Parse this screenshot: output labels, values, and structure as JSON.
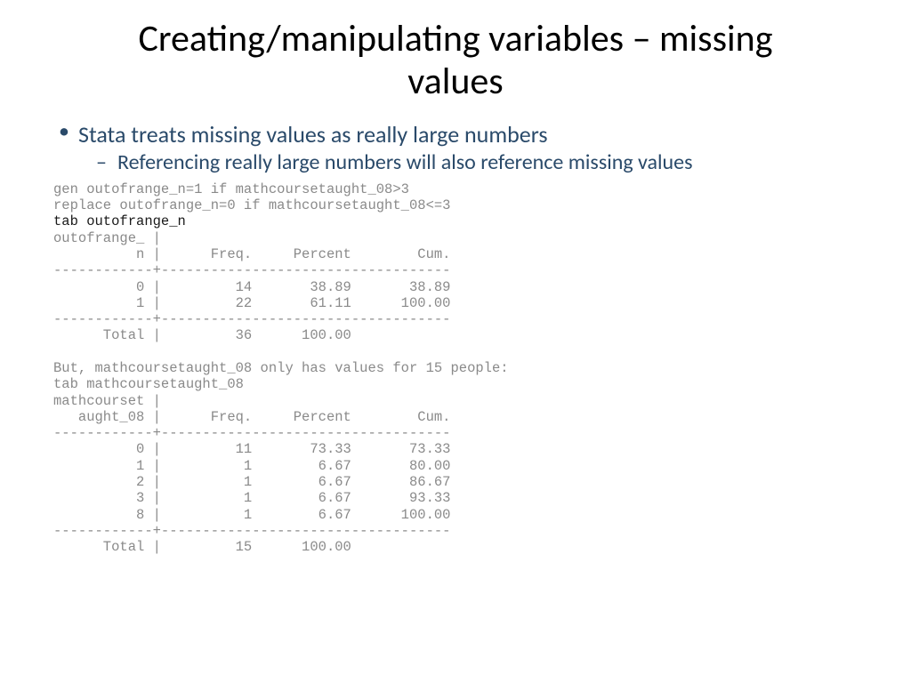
{
  "title": "Creating/manipulating variables – missing values",
  "bullets": {
    "outer": "Stata treats missing values as really large numbers",
    "inner": "Referencing really large numbers will also reference missing values"
  },
  "code": {
    "l1": "gen outofrange_n=1 if mathcoursetaught_08>3",
    "l2": "replace outofrange_n=0 if mathcoursetaught_08<=3",
    "l3": "tab outofrange_n",
    "l4": "outofrange_ |",
    "l5": "          n |      Freq.     Percent        Cum.",
    "l6": "------------+-----------------------------------",
    "l7": "          0 |         14       38.89       38.89",
    "l8": "          1 |         22       61.11      100.00",
    "l9": "------------+-----------------------------------",
    "l10": "      Total |         36      100.00",
    "l11": "",
    "l12": "But, mathcoursetaught_08 only has values for 15 people:",
    "l13": "tab mathcoursetaught_08",
    "l14": "mathcourset |",
    "l15": "   aught_08 |      Freq.     Percent        Cum.",
    "l16": "------------+-----------------------------------",
    "l17": "          0 |         11       73.33       73.33",
    "l18": "          1 |          1        6.67       80.00",
    "l19": "          2 |          1        6.67       86.67",
    "l20": "          3 |          1        6.67       93.33",
    "l21": "          8 |          1        6.67      100.00",
    "l22": "------------+-----------------------------------",
    "l23": "      Total |         15      100.00"
  }
}
